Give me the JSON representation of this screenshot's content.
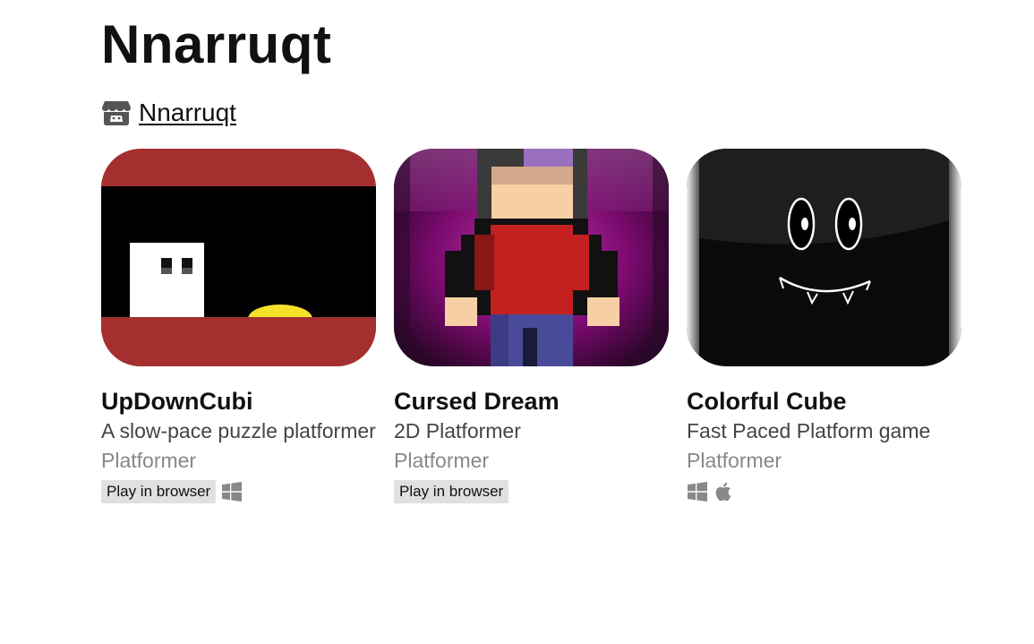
{
  "page": {
    "title": "Nnarruqt",
    "creator_link": "Nnarruqt",
    "creator_icon": "itchio-icon"
  },
  "games": [
    {
      "title": "UpDownCubi",
      "description": "A slow-pace puzzle platformer",
      "genre": "Platformer",
      "badge": "Play in browser",
      "platform_icons": [
        "windows-icon"
      ]
    },
    {
      "title": "Cursed Dream",
      "description": "2D Platformer",
      "genre": "Platformer",
      "badge": "Play in browser",
      "platform_icons": []
    },
    {
      "title": "Colorful Cube",
      "description": "Fast Paced Platform game",
      "genre": "Platformer",
      "badge": "",
      "platform_icons": [
        "windows-icon",
        "apple-icon"
      ]
    }
  ],
  "colors": {
    "platform_icon": "#888888",
    "badge_bg": "#e0e0e0"
  }
}
